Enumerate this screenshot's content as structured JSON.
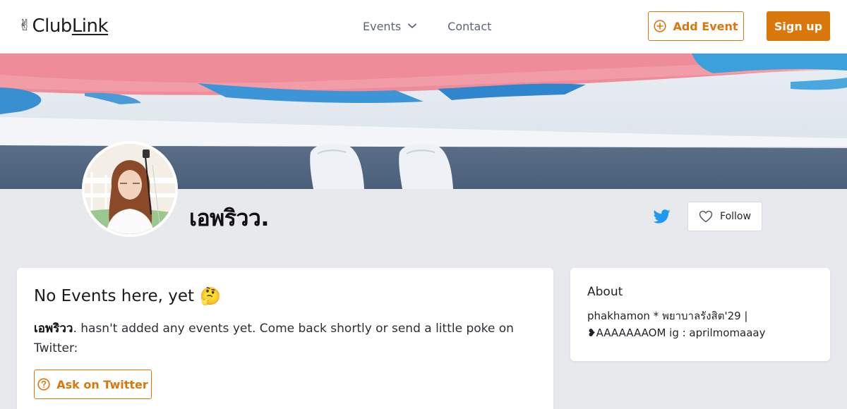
{
  "header": {
    "logo": {
      "emoji": "✌",
      "text_club": "Club",
      "text_link": "Link"
    },
    "nav": {
      "events_label": "Events",
      "contact_label": "Contact"
    },
    "add_event_label": "Add Event",
    "signup_label": "Sign up"
  },
  "profile": {
    "name": "เอพริวว.",
    "follow_label": "Follow"
  },
  "events": {
    "title": "No Events here, yet",
    "emoji": "🤔",
    "text_name": "เอพริวว",
    "text_rest": ". hasn't added any events yet. Come back shortly or send a little poke on Twitter:",
    "ask_label": "Ask on Twitter"
  },
  "about": {
    "title": "About",
    "text": "phakhamon * พยาบาลรังสิต'29 | ❥AAAAAAAOM ig : aprilmomaaay"
  },
  "colors": {
    "accent": "#d9770a",
    "twitter": "#1d9bf0",
    "background": "#e8e9ec",
    "card": "#ffffff"
  },
  "icons": {
    "events_dropdown": "chevron-down-icon",
    "add_event": "plus-circle-icon",
    "twitter": "twitter-bird-icon",
    "follow": "heart-icon",
    "ask": "question-circle-icon"
  }
}
